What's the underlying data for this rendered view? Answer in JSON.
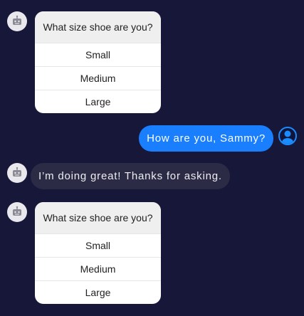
{
  "colors": {
    "background": "#17173a",
    "user_bubble": "#1a7fff",
    "bot_bubble": "#2b2b45",
    "card_header": "#efefef"
  },
  "messages": [
    {
      "sender": "bot",
      "type": "options_card",
      "question": "What size shoe are you?",
      "options": [
        "Small",
        "Medium",
        "Large"
      ]
    },
    {
      "sender": "user",
      "type": "text",
      "text": "How are you, Sammy?"
    },
    {
      "sender": "bot",
      "type": "text",
      "text": "I’m doing great! Thanks for asking."
    },
    {
      "sender": "bot",
      "type": "options_card",
      "question": "What size shoe are you?",
      "options": [
        "Small",
        "Medium",
        "Large"
      ]
    }
  ]
}
